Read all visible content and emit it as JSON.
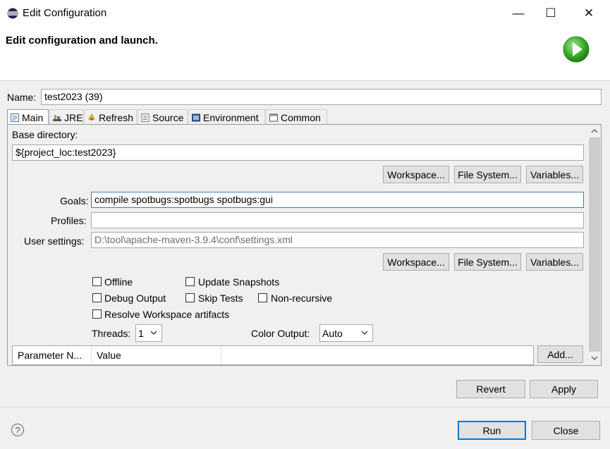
{
  "window": {
    "title": "Edit Configuration",
    "minimize_glyph": "—",
    "maximize_glyph": "☐",
    "close_glyph": "✕"
  },
  "header": {
    "text": "Edit configuration and launch."
  },
  "name": {
    "label": "Name:",
    "value": "test2023 (39)"
  },
  "tabs": [
    {
      "label": "Main",
      "icon": "main-tab-icon"
    },
    {
      "label": "JRE",
      "icon": "jre-icon"
    },
    {
      "label": "Refresh",
      "icon": "refresh-icon"
    },
    {
      "label": "Source",
      "icon": "source-icon"
    },
    {
      "label": "Environment",
      "icon": "environment-icon"
    },
    {
      "label": "Common",
      "icon": "common-icon"
    }
  ],
  "main": {
    "base_dir_label": "Base directory:",
    "base_dir_value": "${project_loc:test2023}",
    "buttons1": {
      "workspace": "Workspace...",
      "file_system": "File System...",
      "variables": "Variables..."
    },
    "goals_label": "Goals:",
    "goals_value": "compile spotbugs:spotbugs spotbugs:gui",
    "profiles_label": "Profiles:",
    "profiles_value": "",
    "user_settings_label": "User settings:",
    "user_settings_value": "D:\\tool\\apache-maven-3.9.4\\conf\\settings.xml",
    "buttons2": {
      "workspace": "Workspace...",
      "file_system": "File System...",
      "variables": "Variables..."
    },
    "checkboxes": {
      "offline": {
        "label": "Offline",
        "checked": false
      },
      "update_snapshots": {
        "label": "Update Snapshots",
        "checked": false
      },
      "debug_output": {
        "label": "Debug Output",
        "checked": false
      },
      "skip_tests": {
        "label": "Skip Tests",
        "checked": false
      },
      "non_recursive": {
        "label": "Non-recursive",
        "checked": false
      },
      "resolve_workspace": {
        "label": "Resolve Workspace artifacts",
        "checked": false
      }
    },
    "threads_label": "Threads:",
    "threads_value": "1",
    "color_output_label": "Color Output:",
    "color_output_value": "Auto",
    "table_headers": [
      "Parameter N...",
      "Value"
    ],
    "add_button": "Add..."
  },
  "footer": {
    "revert": "Revert",
    "apply": "Apply",
    "run": "Run",
    "close": "Close",
    "help_glyph": "?"
  },
  "colors": {
    "accent": "#0078d7",
    "run_green": "#3cae2a"
  }
}
